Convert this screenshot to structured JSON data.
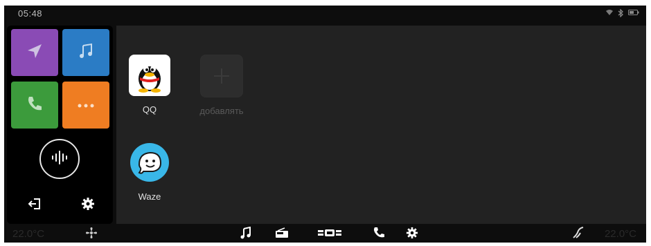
{
  "status_bar": {
    "time": "05:48",
    "icons": [
      "wifi-icon",
      "bluetooth-icon",
      "battery-icon"
    ]
  },
  "left_panel": {
    "tiles": [
      {
        "name": "navigation",
        "icon": "navigation-arrow-icon",
        "color": "#8a4bb5"
      },
      {
        "name": "music",
        "icon": "music-note-icon",
        "color": "#2b7cc5"
      },
      {
        "name": "phone",
        "icon": "phone-icon",
        "color": "#3c9b3c"
      },
      {
        "name": "more",
        "icon": "more-dots-icon",
        "color": "#ef7d22"
      }
    ],
    "voice_button": {
      "icon": "voice-assistant-icon"
    },
    "bottom_icons": [
      "exit-icon",
      "settings-gear-icon"
    ]
  },
  "apps": [
    {
      "label": "QQ",
      "icon": "qq-penguin-icon"
    },
    {
      "label": "добавлять",
      "icon": "plus-icon"
    },
    {
      "label": "Waze",
      "icon": "waze-icon"
    }
  ],
  "bottom_bar": {
    "temp_left": "22.0°C",
    "temp_right": "22.0°C",
    "icons": [
      "fan-icon",
      "music-note-icon",
      "radio-icon",
      "car-icon",
      "phone-icon",
      "settings-gear-icon",
      "seat-heat-icon"
    ]
  },
  "colors": {
    "screen_bg": "#0d0d0d",
    "main_panel_bg": "#222222",
    "tile_nav": "#8a4bb5",
    "tile_music": "#2b7cc5",
    "tile_phone": "#3c9b3c",
    "tile_more": "#ef7d22"
  }
}
